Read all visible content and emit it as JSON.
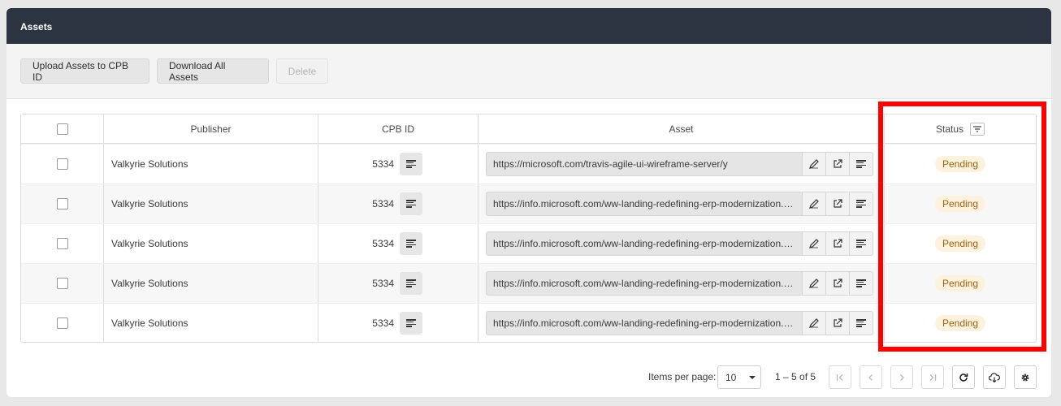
{
  "header": {
    "title": "Assets"
  },
  "toolbar": {
    "upload_label": "Upload Assets to CPB ID",
    "download_label": "Download All Assets",
    "delete_label": "Delete"
  },
  "table": {
    "columns": {
      "publisher": "Publisher",
      "cpb_id": "CPB ID",
      "asset": "Asset",
      "status": "Status"
    },
    "rows": [
      {
        "publisher": "Valkyrie Solutions",
        "cpb_id": "5334",
        "asset": "https://microsoft.com/travis-agile-ui-wireframe-server/y",
        "status": "Pending"
      },
      {
        "publisher": "Valkyrie Solutions",
        "cpb_id": "5334",
        "asset": "https://info.microsoft.com/ww-landing-redefining-erp-modernization.ht...",
        "status": "Pending"
      },
      {
        "publisher": "Valkyrie Solutions",
        "cpb_id": "5334",
        "asset": "https://info.microsoft.com/ww-landing-redefining-erp-modernization.ht...",
        "status": "Pending"
      },
      {
        "publisher": "Valkyrie Solutions",
        "cpb_id": "5334",
        "asset": "https://info.microsoft.com/ww-landing-redefining-erp-modernization.ht...",
        "status": "Pending"
      },
      {
        "publisher": "Valkyrie Solutions",
        "cpb_id": "5334",
        "asset": "https://info.microsoft.com/ww-landing-redefining-erp-modernization.ht...",
        "status": "Pending"
      }
    ]
  },
  "paginator": {
    "items_per_page_label": "Items per page:",
    "items_per_page_value": "10",
    "range_label": "1 – 5 of 5"
  },
  "icons": {
    "copy": "lines-icon",
    "edit": "pencil-icon",
    "open": "external-link-icon",
    "filter": "filter-icon",
    "refresh": "refresh-icon",
    "download": "cloud-download-icon",
    "settings": "gear-icon"
  },
  "colors": {
    "header_bg": "#2b3440",
    "status_pending_bg": "#fcf2dd",
    "status_pending_text": "#9a6212",
    "highlight": "#ff0000"
  }
}
